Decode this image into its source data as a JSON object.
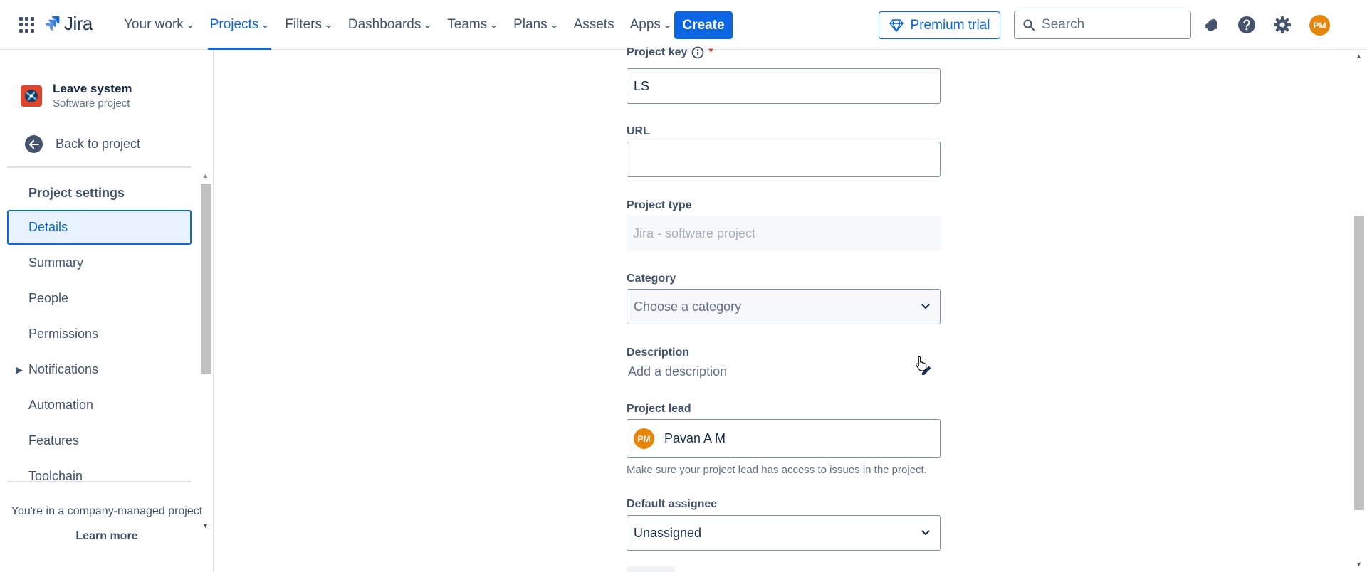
{
  "app": {
    "name": "Jira"
  },
  "nav": {
    "items": [
      {
        "label": "Your work",
        "has_menu": true
      },
      {
        "label": "Projects",
        "has_menu": true,
        "active": true
      },
      {
        "label": "Filters",
        "has_menu": true
      },
      {
        "label": "Dashboards",
        "has_menu": true
      },
      {
        "label": "Teams",
        "has_menu": true
      },
      {
        "label": "Plans",
        "has_menu": true
      },
      {
        "label": "Assets",
        "has_menu": false
      },
      {
        "label": "Apps",
        "has_menu": true
      }
    ],
    "create_label": "Create",
    "premium_label": "Premium trial",
    "search_placeholder": "Search",
    "avatar_initials": "PM"
  },
  "sidebar": {
    "project_name": "Leave system",
    "project_type": "Software project",
    "back_label": "Back to project",
    "section_title": "Project settings",
    "items": [
      {
        "label": "Details",
        "selected": true
      },
      {
        "label": "Summary"
      },
      {
        "label": "People"
      },
      {
        "label": "Permissions"
      },
      {
        "label": "Notifications",
        "expandable": true
      },
      {
        "label": "Automation"
      },
      {
        "label": "Features"
      },
      {
        "label": "Toolchain"
      }
    ],
    "footer_text": "You're in a company-managed project",
    "learn_more": "Learn more"
  },
  "form": {
    "project_key": {
      "label": "Project key",
      "required_mark": "*",
      "value": "LS"
    },
    "url": {
      "label": "URL",
      "value": ""
    },
    "project_type": {
      "label": "Project type",
      "value": "Jira - software project"
    },
    "category": {
      "label": "Category",
      "placeholder": "Choose a category"
    },
    "description": {
      "label": "Description",
      "placeholder": "Add a description"
    },
    "project_lead": {
      "label": "Project lead",
      "initials": "PM",
      "name": "Pavan A M",
      "helper": "Make sure your project lead has access to issues in the project."
    },
    "default_assignee": {
      "label": "Default assignee",
      "value": "Unassigned"
    }
  },
  "colors": {
    "accent": "#0c66e4",
    "project_icon": "#e0452b",
    "avatar": "#e8860b"
  }
}
